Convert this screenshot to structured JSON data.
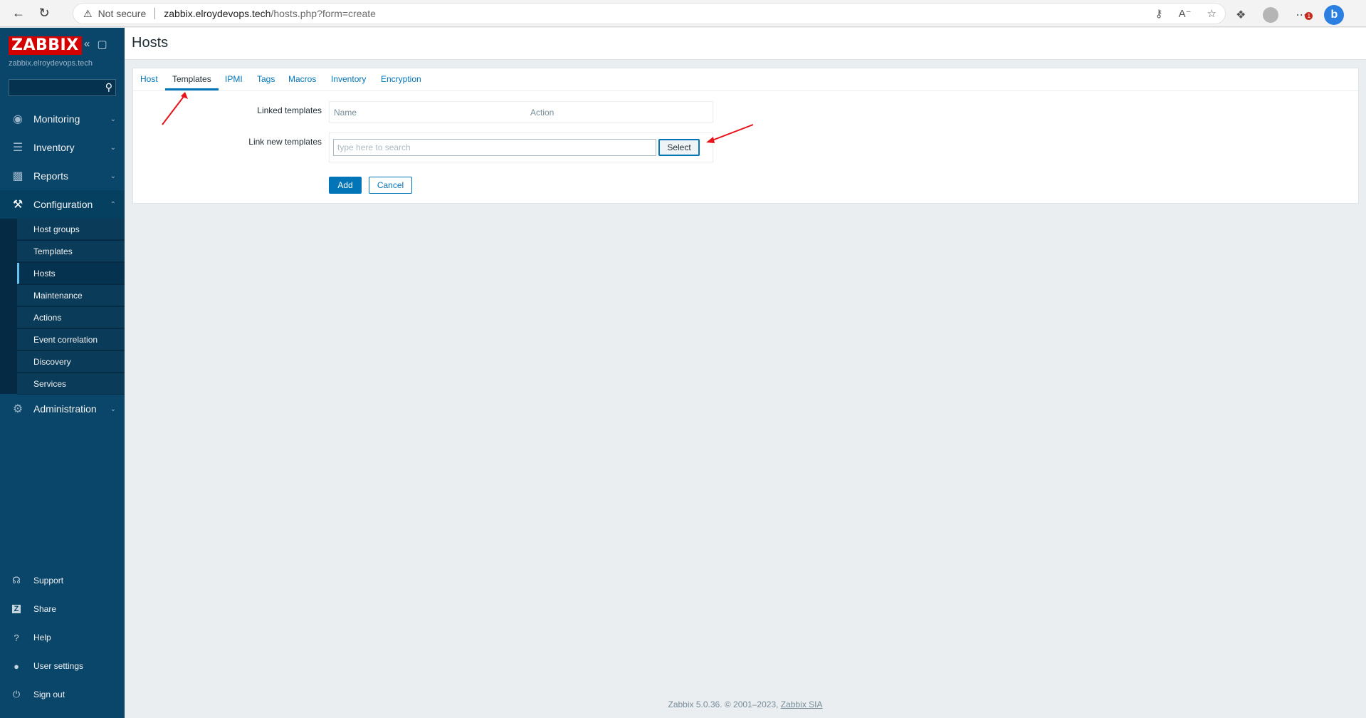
{
  "browser": {
    "not_secure": "Not secure",
    "url_host": "zabbix.elroydevops.tech",
    "url_path": "/hosts.php?form=create",
    "notification_count": "1",
    "bing_label": "b"
  },
  "sidebar": {
    "logo": "ZABBIX",
    "server_name": "zabbix.elroydevops.tech",
    "search_placeholder": "",
    "menu": [
      {
        "label": "Monitoring",
        "icon": "eye-icon"
      },
      {
        "label": "Inventory",
        "icon": "list-icon"
      },
      {
        "label": "Reports",
        "icon": "bar-chart-icon"
      },
      {
        "label": "Configuration",
        "icon": "wrench-icon"
      },
      {
        "label": "Administration",
        "icon": "gear-icon"
      }
    ],
    "configuration_items": [
      "Host groups",
      "Templates",
      "Hosts",
      "Maintenance",
      "Actions",
      "Event correlation",
      "Discovery",
      "Services"
    ],
    "bottom": [
      {
        "label": "Support",
        "icon": "headset-icon"
      },
      {
        "label": "Share",
        "icon": "share-z-icon"
      },
      {
        "label": "Help",
        "icon": "question-icon"
      },
      {
        "label": "User settings",
        "icon": "user-icon"
      },
      {
        "label": "Sign out",
        "icon": "power-icon"
      }
    ]
  },
  "page": {
    "title": "Hosts",
    "tabs": [
      "Host",
      "Templates",
      "IPMI",
      "Tags",
      "Macros",
      "Inventory",
      "Encryption"
    ],
    "active_tab": "Templates",
    "linked_templates_label": "Linked templates",
    "col_name": "Name",
    "col_action": "Action",
    "link_new_label": "Link new templates",
    "search_placeholder": "type here to search",
    "select_label": "Select",
    "add_label": "Add",
    "cancel_label": "Cancel"
  },
  "footer": {
    "text": "Zabbix 5.0.36. © 2001–2023, ",
    "link": "Zabbix SIA"
  },
  "colors": {
    "sidebar_bg": "#0a466a",
    "accent": "#0275b8",
    "logo_red": "#d40000",
    "annotation_arrow": "#e8131b"
  }
}
